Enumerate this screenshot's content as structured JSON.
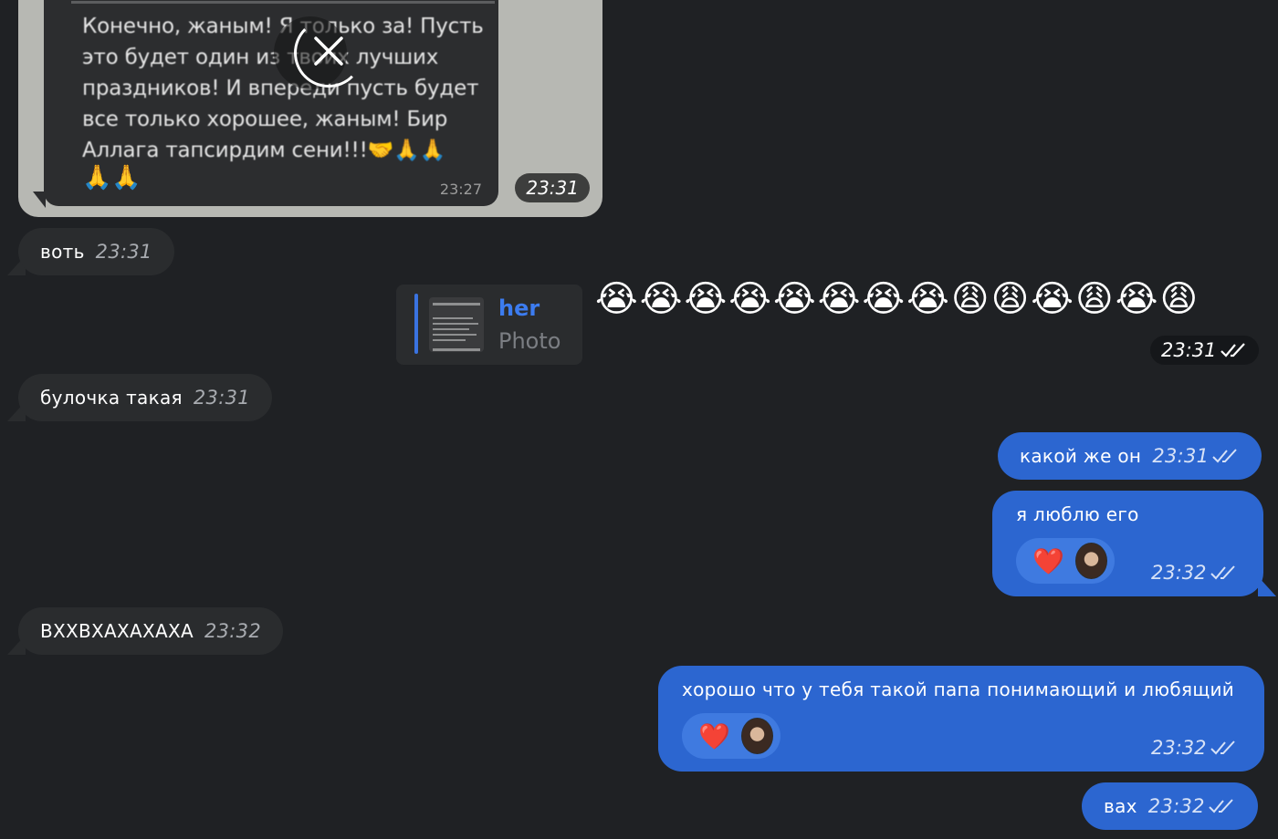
{
  "photo_message": {
    "text": "Конечно, жаным! Я только за! Пусть это будет один из твоих лучших праздников! И впереди пусть будет все только хорошее, жаным! Бир Аллага тапсирдим сени!!!",
    "emoji": "🤝🙏🙏",
    "emoji_line2": "🙏🙏",
    "inner_time": "23:27",
    "time": "23:31"
  },
  "messages": [
    {
      "text": "воть",
      "time": "23:31",
      "direction": "in"
    },
    {
      "text": "булочка такая",
      "time": "23:31",
      "direction": "in"
    },
    {
      "text": "какой же он",
      "time": "23:31",
      "direction": "out"
    },
    {
      "text": "я люблю его",
      "time": "23:32",
      "direction": "out",
      "reaction": "❤️"
    },
    {
      "text": "ВХХВХАХАХАХА",
      "time": "23:32",
      "direction": "in"
    },
    {
      "text": "хорошо что у тебя такой папа понимающий и любящий",
      "time": "23:32",
      "direction": "out",
      "reaction": "❤️"
    },
    {
      "text": "вах",
      "time": "23:32",
      "direction": "out"
    }
  ],
  "reply": {
    "name": "her",
    "subtitle": "Photo"
  },
  "emoji_message": {
    "emojis": "😭😭😭😭😭😭😭😭😩😩😭😩😭😩",
    "time": "23:31"
  },
  "colors": {
    "background": "#1f2124",
    "incoming_bubble": "#2a2c2e",
    "outgoing_bubble": "#2c66d0",
    "accent": "#3c7cf0"
  }
}
